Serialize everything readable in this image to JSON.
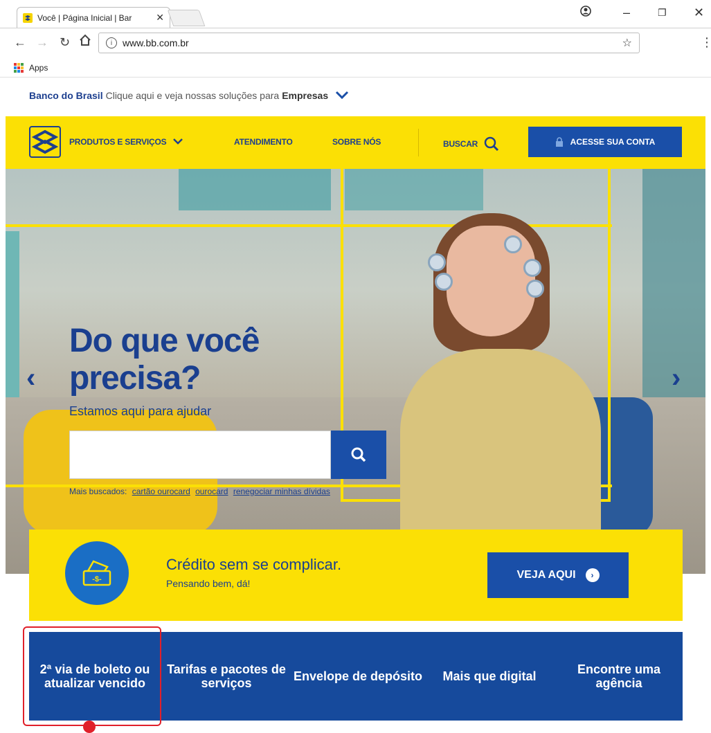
{
  "browser": {
    "tab_title": "Você | Página Inicial | Bar",
    "url": "www.bb.com.br",
    "bookmarks_label": "Apps"
  },
  "topbar": {
    "brand": "Banco do Brasil",
    "text": "Clique aqui e veja nossas soluções para",
    "emphasis": "Empresas"
  },
  "nav": {
    "products": "PRODUTOS E SERVIÇOS",
    "service": "ATENDIMENTO",
    "about": "SOBRE NÓS",
    "search": "BUSCAR",
    "account": "ACESSE SUA CONTA"
  },
  "hero": {
    "headline_1": "Do que você",
    "headline_2": "precisa?",
    "subline": "Estamos aqui para ajudar",
    "search_value": "",
    "popular_label": "Mais buscados:",
    "popular_links": [
      "cartão ourocard",
      "ourocard",
      "renegociar minhas dívidas"
    ]
  },
  "credit": {
    "title": "Crédito sem se complicar.",
    "subtitle": "Pensando bem, dá!",
    "cta": "VEJA AQUI"
  },
  "quick_links": [
    "2ª via de boleto ou atualizar vencido",
    "Tarifas e pacotes de serviços",
    "Envelope de depósito",
    "Mais que digital",
    "Encontre uma agência"
  ],
  "colors": {
    "yellow": "#fbe005",
    "blue": "#1a4fa8",
    "dark_blue": "#164a9c",
    "highlight_red": "#e0202a"
  }
}
